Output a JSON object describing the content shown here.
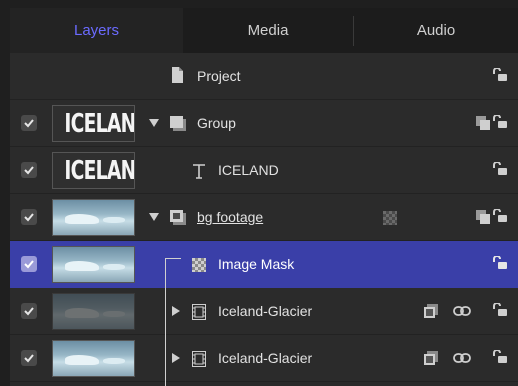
{
  "tabs": [
    {
      "label": "Layers",
      "active": true
    },
    {
      "label": "Media",
      "active": false
    },
    {
      "label": "Audio",
      "active": false
    }
  ],
  "rows": [
    {
      "label": "Project",
      "type": "project"
    },
    {
      "label": "Group",
      "type": "group",
      "thumb_text": "ICELAND"
    },
    {
      "label": "ICELAND",
      "type": "text",
      "thumb_text": "ICELAND"
    },
    {
      "label": "bg footage",
      "type": "group-sub"
    },
    {
      "label": "Image Mask",
      "type": "mask",
      "selected": true
    },
    {
      "label": "Iceland-Glacier",
      "type": "clip"
    },
    {
      "label": "Iceland-Glacier",
      "type": "clip"
    }
  ],
  "icons": [
    "checkbox-icon",
    "document-icon",
    "group-icon",
    "text-layer-icon",
    "mask-icon",
    "film-icon",
    "link-icon",
    "lock-icon",
    "disclosure-triangle-icon"
  ],
  "colors": {
    "accent": "#6b6bff",
    "selection": "#3a3fa8",
    "background": "#2a2a2a"
  }
}
